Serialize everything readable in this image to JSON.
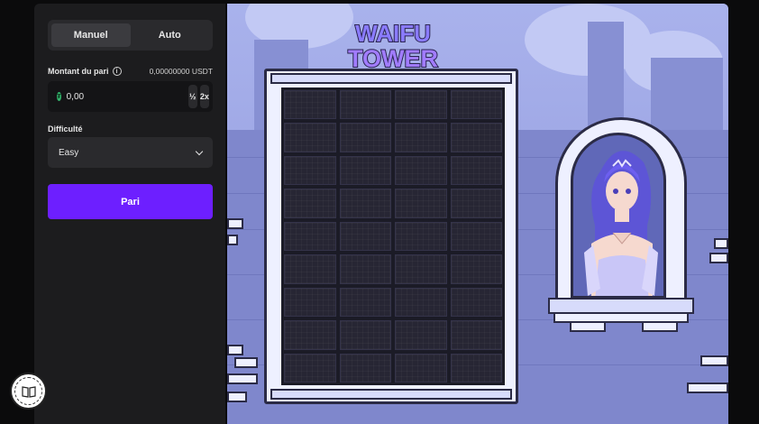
{
  "panel": {
    "modes": [
      "Manuel",
      "Auto"
    ],
    "active_mode": "Manuel",
    "bet_label": "Montant du pari",
    "balance": "0,00000000 USDT",
    "amount": "0,00",
    "half_label": "½",
    "double_label": "2x",
    "difficulty_label": "Difficulté",
    "difficulty_value": "Easy",
    "bet_button": "Pari"
  },
  "game": {
    "logo_line1": "WAIFU",
    "logo_line2": "TOWER",
    "grid_rows": 9,
    "grid_cols": 4
  },
  "colors": {
    "accent": "#6d1fff",
    "panel_bg": "#1c1c1e",
    "sky": "#a9b2ec"
  }
}
